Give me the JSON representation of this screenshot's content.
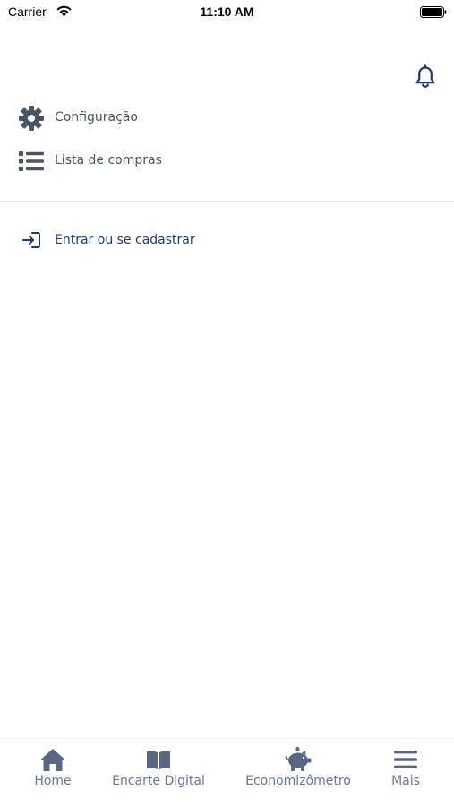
{
  "status_bar": {
    "carrier": "Carrier",
    "time": "11:10 AM"
  },
  "header": {
    "icon": "bell-icon"
  },
  "menu": {
    "items": [
      {
        "label": "Configuração",
        "icon": "gear-icon"
      },
      {
        "label": "Lista de compras",
        "icon": "list-icon"
      }
    ]
  },
  "auth": {
    "label": "Entrar ou se cadastrar",
    "icon": "sign-in-icon"
  },
  "tab_bar": {
    "tabs": [
      {
        "label": "Home",
        "icon": "home-icon"
      },
      {
        "label": "Encarte Digital",
        "icon": "book-open-icon"
      },
      {
        "label": "Economizômetro",
        "icon": "piggy-bank-icon"
      },
      {
        "label": "Mais",
        "icon": "menu-icon"
      }
    ]
  },
  "colors": {
    "text": "#4a5468",
    "link": "#1d3a72",
    "tab_icon": "#5b6682",
    "divider": "#e7e8ec"
  }
}
